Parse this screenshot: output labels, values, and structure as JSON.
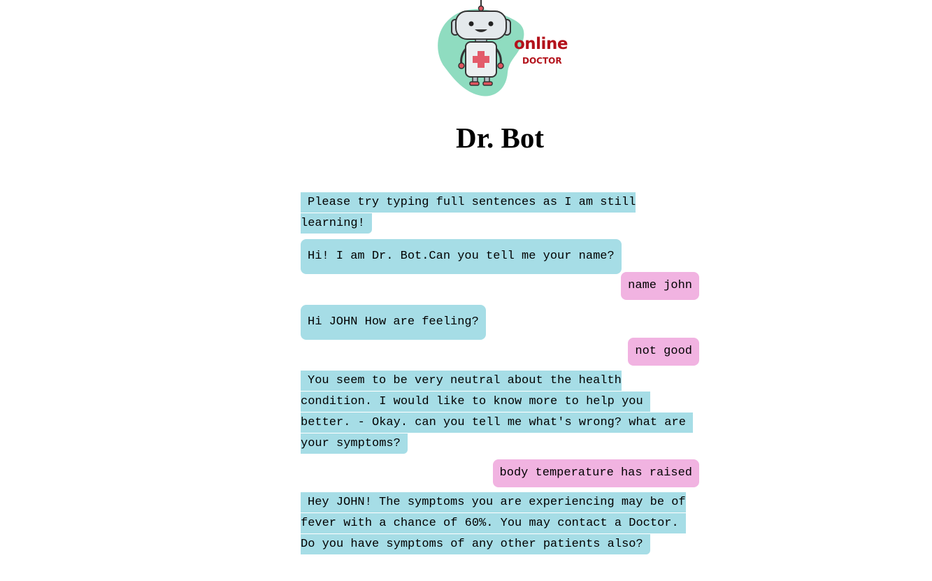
{
  "app": {
    "title": "Dr. Bot",
    "logo": {
      "word_main": "online",
      "word_sub": "DOCTOR"
    }
  },
  "colors": {
    "bot_bubble": "#a6dde6",
    "user_bubble": "#f1b3e1",
    "logo_blob": "#8fdcc0",
    "logo_text": "#b3121b"
  },
  "messages": [
    {
      "sender": "bot",
      "lines": [
        "Please try typing full sentences as I am still",
        "learning!"
      ]
    },
    {
      "sender": "bot",
      "lines": [
        "Hi! I am Dr. Bot.Can you tell me your name?"
      ]
    },
    {
      "sender": "user",
      "lines": [
        "name john"
      ]
    },
    {
      "sender": "bot",
      "lines": [
        "Hi JOHN How are feeling?"
      ]
    },
    {
      "sender": "user",
      "lines": [
        "not good"
      ]
    },
    {
      "sender": "bot",
      "lines": [
        "You seem to be very neutral about the health",
        "condition. I would like to know more to help you",
        "better. - Okay. can you tell me what's wrong? what are",
        "your symptoms?"
      ]
    },
    {
      "sender": "user",
      "lines": [
        "body temperature has raised"
      ]
    },
    {
      "sender": "bot",
      "lines": [
        "Hey JOHN! The symptoms you are experiencing may be of",
        "fever with a chance of 60%. You may contact a Doctor.",
        "Do you have symptoms of any other patients also?"
      ]
    }
  ]
}
